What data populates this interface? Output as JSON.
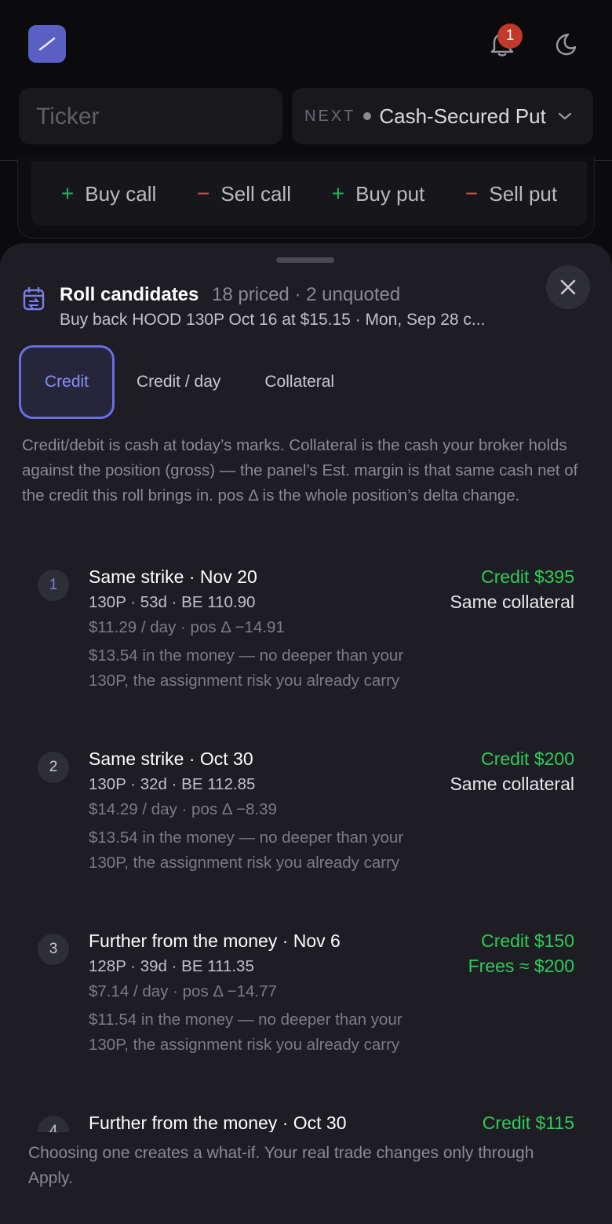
{
  "header": {
    "notification_count": "1",
    "ticker_placeholder": "Ticker",
    "strategy_next_label": "NEXT",
    "strategy_value": "Cash-Secured Put"
  },
  "legs": [
    {
      "symbol": "+",
      "label": "Buy call"
    },
    {
      "symbol": "−",
      "label": "Sell call"
    },
    {
      "symbol": "+",
      "label": "Buy put"
    },
    {
      "symbol": "−",
      "label": "Sell put"
    }
  ],
  "sheet": {
    "title": "Roll candidates",
    "meta": "18 priced · 2 unquoted",
    "subtitle": "Buy back HOOD 130P Oct 16 at $15.15 · Mon, Sep 28 c...",
    "tabs": [
      "Credit",
      "Credit / day",
      "Collateral"
    ],
    "active_tab": "Credit",
    "explanation": "Credit/debit is cash at today’s marks. Collateral is the cash your broker holds against the position (gross) — the panel’s Est. margin is that same cash net of the credit this roll brings in. pos Δ is the whole position’s delta change.",
    "footer": "Choosing one creates a what-if. Your real trade changes only through Apply."
  },
  "candidates": [
    {
      "num": "1",
      "title": "Same strike · Nov 20",
      "line1": "130P · 53d · BE 110.90",
      "line2": "$11.29 / day · pos Δ −14.91",
      "note": "$13.54 in the money — no deeper than your 130P, the assignment risk you already carry",
      "credit": "Credit $395",
      "collateral": "Same collateral"
    },
    {
      "num": "2",
      "title": "Same strike · Oct 30",
      "line1": "130P · 32d · BE 112.85",
      "line2": "$14.29 / day · pos Δ −8.39",
      "note": "$13.54 in the money — no deeper than your 130P, the assignment risk you already carry",
      "credit": "Credit $200",
      "collateral": "Same collateral"
    },
    {
      "num": "3",
      "title": "Further from the money · Nov 6",
      "line1": "128P · 39d · BE 111.35",
      "line2": "$7.14 / day · pos Δ −14.77",
      "note": "$11.54 in the money — no deeper than your 130P, the assignment risk you already carry",
      "credit": "Credit $150",
      "collateral": "Frees ≈ $200"
    },
    {
      "num": "4",
      "title": "Further from the money · Oct 30",
      "line1": "",
      "line2": "",
      "note": "",
      "credit": "Credit $115",
      "collateral": ""
    }
  ],
  "colors": {
    "accent": "#6a6ee6",
    "credit_green": "#2ecc5a",
    "badge_red": "#c0392b"
  }
}
